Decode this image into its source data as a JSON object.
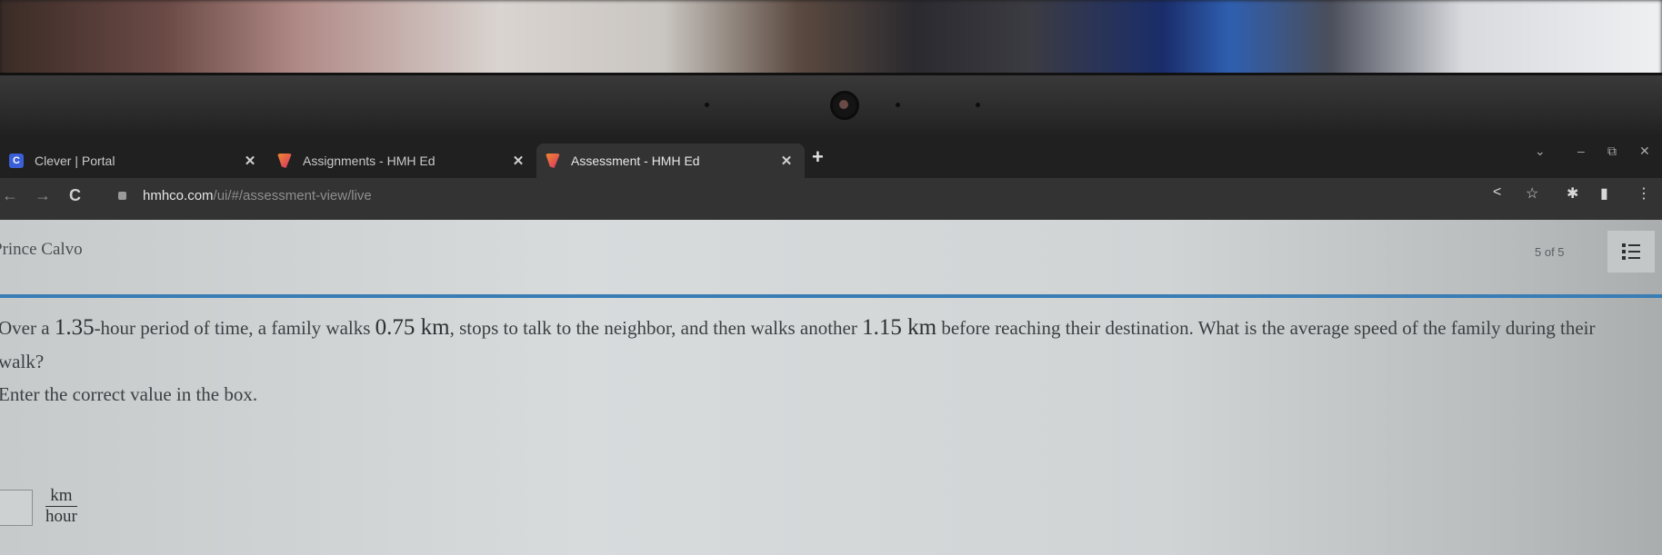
{
  "browser": {
    "tabs": [
      {
        "title": "Clever | Portal",
        "favicon": "clever-icon",
        "active": false
      },
      {
        "title": "Assignments - HMH Ed",
        "favicon": "hmh-icon",
        "active": false
      },
      {
        "title": "Assessment - HMH Ed",
        "favicon": "hmh-icon",
        "active": true
      }
    ],
    "close_glyph": "✕",
    "new_tab_glyph": "+",
    "window_controls": {
      "tab_search": "⌄",
      "minimize": "–",
      "restore": "⧉",
      "close": "✕"
    },
    "nav": {
      "back": "←",
      "forward": "→",
      "reload": "C"
    },
    "url_host": "hmhco.com",
    "url_path": "/ui/#/assessment-view/live",
    "toolbar_icons": {
      "share": "<",
      "bookmark": "☆",
      "extensions": "✱",
      "sidepanel": "▮",
      "menu": "⋮"
    }
  },
  "header": {
    "student_name": "Prince Calvo",
    "question_counter": "5 of 5"
  },
  "question": {
    "part1": "Over a ",
    "time": "1.35",
    "part2": "-hour period of time, a family walks ",
    "distance1": "0.75 km",
    "part3": ", stops to talk to the neighbor, and then walks another ",
    "distance2": "1.15 km",
    "part4": " before reaching their destination. What is the average speed of the family during their walk?",
    "instruction": "Enter the correct value in the box."
  },
  "answer": {
    "value": "",
    "unit_numerator": "km",
    "unit_denominator": "hour"
  }
}
